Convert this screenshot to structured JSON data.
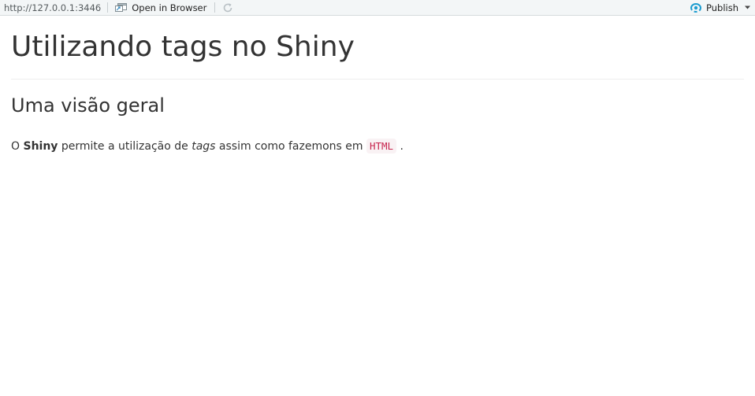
{
  "toolbar": {
    "url": "http://127.0.0.1:3446",
    "open_in_browser_label": "Open in Browser",
    "publish_label": "Publish",
    "accent_color": "#1a9bcf"
  },
  "page": {
    "title": "Utilizando tags no Shiny",
    "subtitle": "Uma visão geral",
    "paragraph": {
      "prefix": "O ",
      "bold": "Shiny",
      "middle1": " permite a utilização de ",
      "italic": "tags",
      "middle2": " assim como fazemons em ",
      "code": "HTML",
      "suffix": " ."
    }
  }
}
